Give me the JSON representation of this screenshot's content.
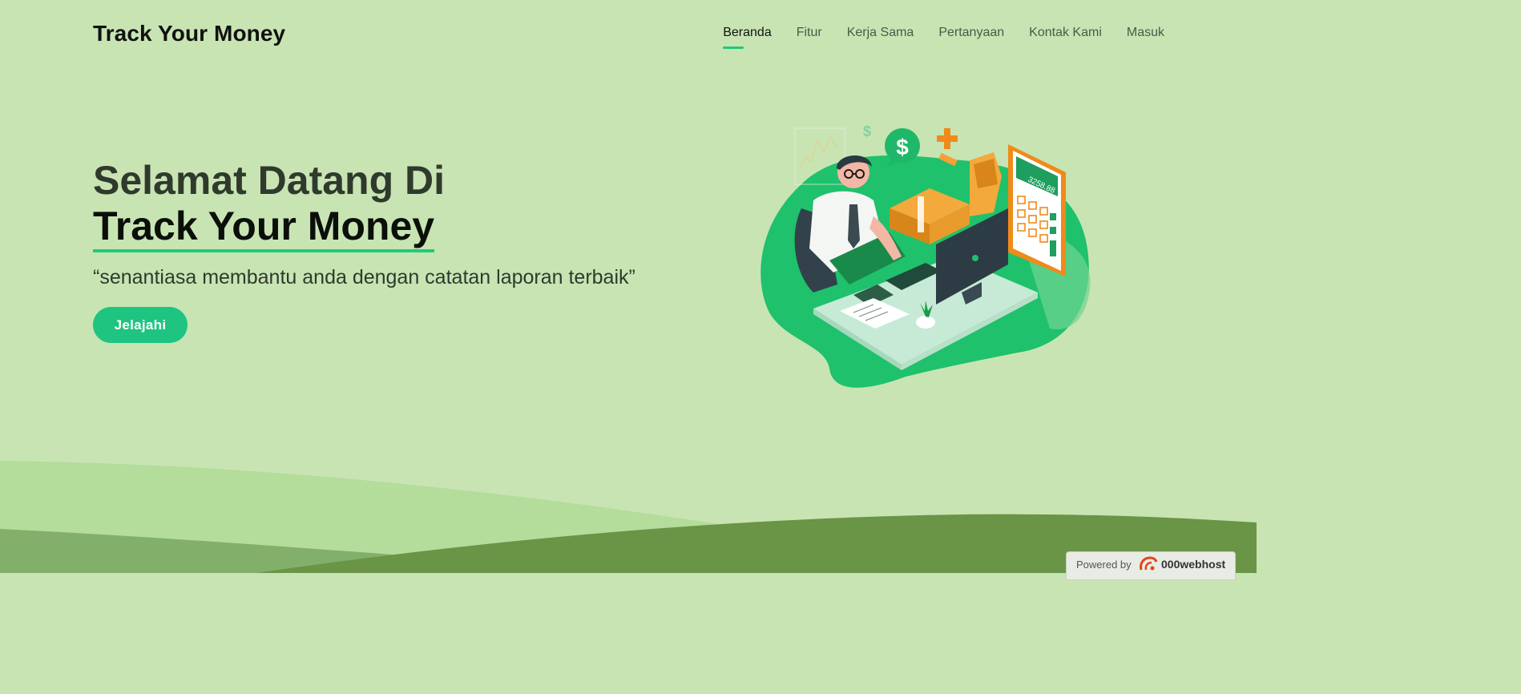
{
  "header": {
    "logo_text": "Track Your Money",
    "nav_items": [
      {
        "label": "Beranda",
        "active": true
      },
      {
        "label": "Fitur",
        "active": false
      },
      {
        "label": "Kerja Sama",
        "active": false
      },
      {
        "label": "Pertanyaan",
        "active": false
      },
      {
        "label": "Kontak Kami",
        "active": false
      },
      {
        "label": "Masuk",
        "active": false
      }
    ]
  },
  "hero": {
    "heading_line1": "Selamat Datang Di",
    "heading_line2": "Track Your Money",
    "tagline": "“senantiasa membantu anda dengan catatan laporan terbaik”",
    "cta_label": "Jelajahi",
    "illustration": {
      "icon": "finance-man-at-desk-illustration",
      "calculator_display": "3258.88"
    }
  },
  "footer_badge": {
    "powered_text": "Powered by",
    "host_name": "000webhost",
    "icon": "000webhost-logo-icon"
  },
  "colors": {
    "background": "#c8e4b3",
    "accent": "#1fc481",
    "wave_light": "#b4dc9a",
    "wave_mid": "#82b06a",
    "wave_dark": "#6a9446"
  }
}
